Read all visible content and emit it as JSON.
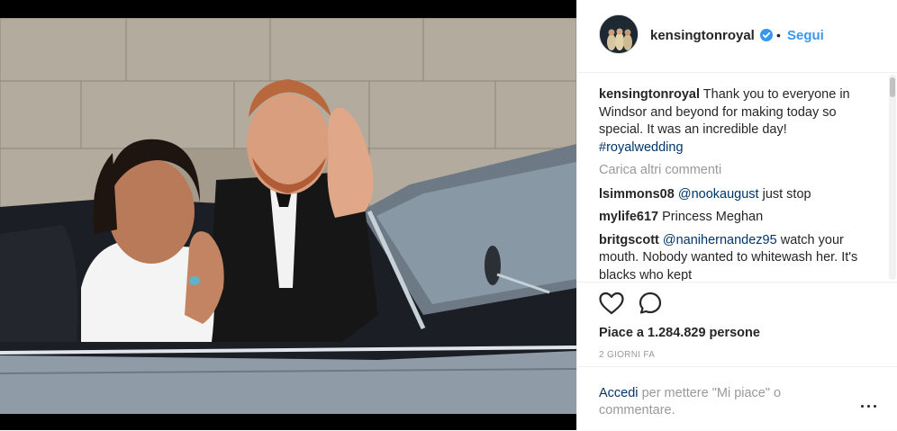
{
  "post": {
    "username": "kensingtonroyal",
    "verified": true,
    "separator": "•",
    "follow_label": "Segui"
  },
  "caption": {
    "username": "kensingtonroyal",
    "text": "Thank you to everyone in Windsor and beyond for making today so special. It was an incredible day!",
    "hashtag": "#royalwedding"
  },
  "load_more_label": "Carica altri commenti",
  "comments": [
    {
      "username": "lsimmons08",
      "mention": "@nookaugust",
      "text": "just stop"
    },
    {
      "username": "mylife617",
      "mention": "",
      "text": "Princess Meghan"
    },
    {
      "username": "britgscott",
      "mention": "@nanihernandez95",
      "text": "watch your mouth. Nobody wanted to whitewash her. It's blacks who kept"
    }
  ],
  "likes_text": "Piace a 1.284.829 persone",
  "time_ago": "2 GIORNI FA",
  "footer": {
    "login_link": "Accedi",
    "login_rest": "per mettere \"Mi piace\" o commentare."
  },
  "icons": {
    "verified": "verified-badge-icon",
    "like": "heart-icon",
    "comment": "comment-bubble-icon",
    "more": "more-options-icon"
  },
  "colors": {
    "link_blue": "#3897f0",
    "verified_blue": "#3897f0",
    "mention_blue": "#003569",
    "muted": "#999999"
  }
}
